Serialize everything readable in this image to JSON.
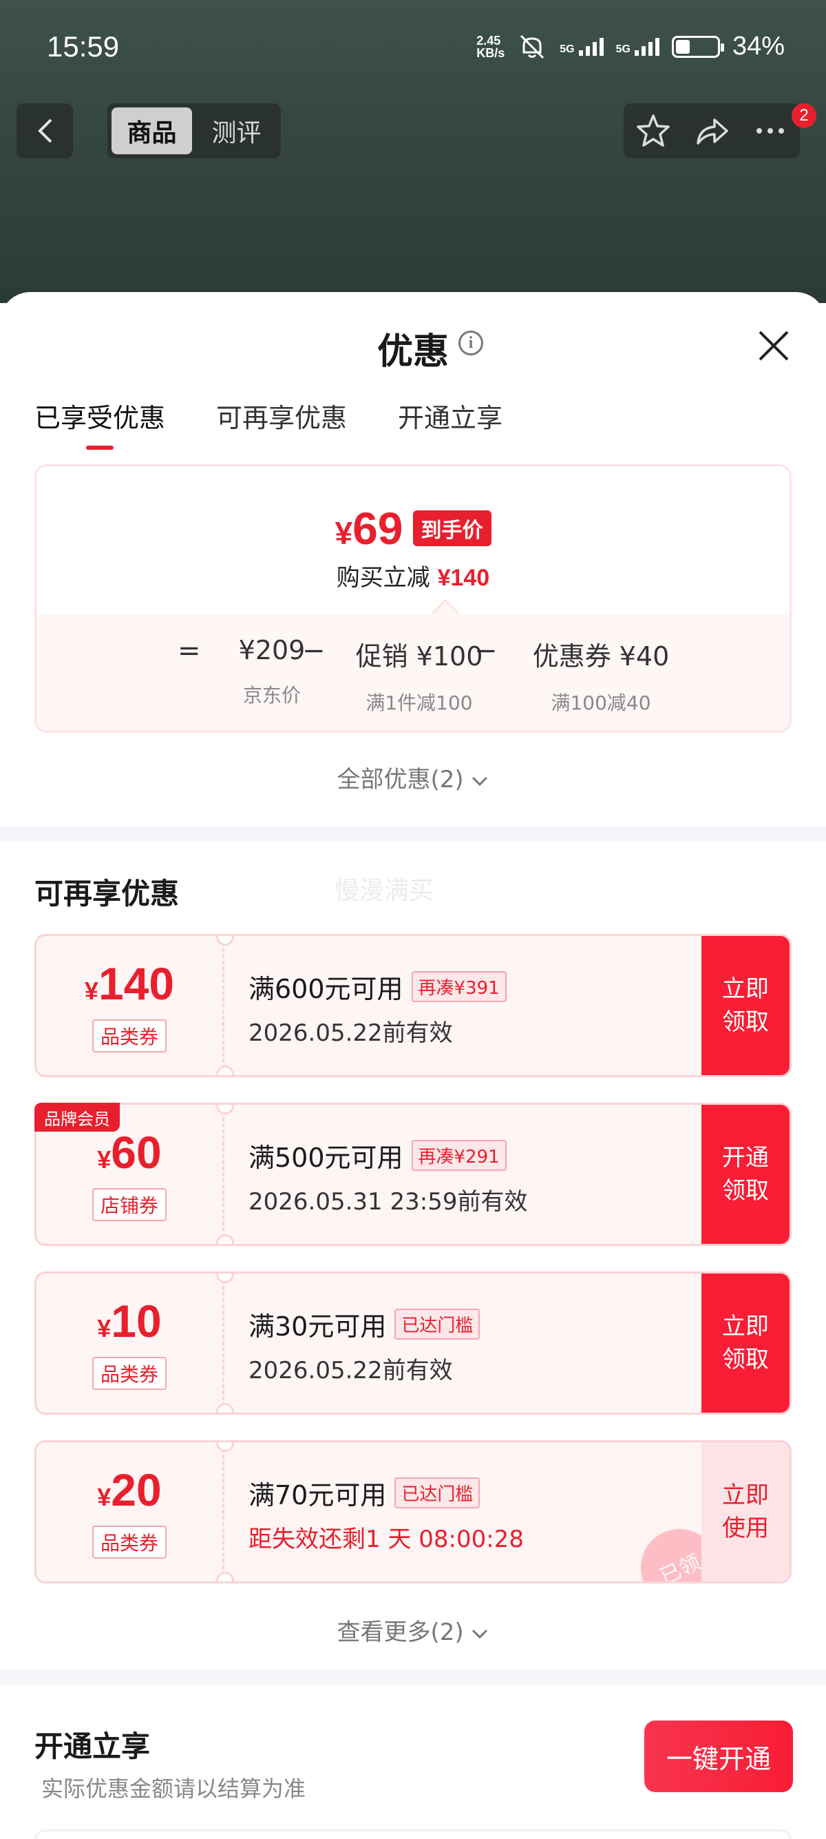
{
  "status_bar": {
    "time": "15:59",
    "net_speed_value": "2.45",
    "net_speed_unit": "KB/s",
    "signal1_label": "5G",
    "signal2_label": "5G",
    "battery_percent": "34%",
    "battery_level": 0.34
  },
  "top_bar": {
    "tabs": [
      "商品",
      "测评"
    ],
    "active_tab": "商品",
    "notification_count": "2"
  },
  "sheet": {
    "title": "优惠",
    "tabs": [
      "已享受优惠",
      "可再享优惠",
      "开通立享"
    ],
    "active_tab": "已享受优惠"
  },
  "price_card": {
    "final_price_symbol": "¥",
    "final_price": "69",
    "final_price_tag": "到手价",
    "reduction_label": "购买立减",
    "reduction_value": "¥140",
    "formula": [
      {
        "op": "=",
        "value": "¥209",
        "label": "京东价"
      },
      {
        "op": "−",
        "value": "促销 ¥100",
        "label": "满1件减100"
      },
      {
        "op": "−",
        "value": "优惠券 ¥40",
        "label": "满100减40"
      }
    ],
    "all_offers_link": "全部优惠(2)"
  },
  "more_offers": {
    "title": "可再享优惠",
    "watermark": "慢漫满买",
    "coupons": [
      {
        "yen": "¥",
        "amount": "140",
        "type": "品类券",
        "condition": "满600元可用",
        "tag": "再凑¥391",
        "validity": "2026.05.22前有效",
        "button": "立即\n领取",
        "badge": ""
      },
      {
        "yen": "¥",
        "amount": "60",
        "type": "店铺券",
        "condition": "满500元可用",
        "tag": "再凑¥291",
        "validity": "2026.05.31 23:59前有效",
        "button": "开通\n领取",
        "badge": "品牌会员"
      },
      {
        "yen": "¥",
        "amount": "10",
        "type": "品类券",
        "condition": "满30元可用",
        "tag": "已达门槛",
        "validity": "2026.05.22前有效",
        "button": "立即\n领取",
        "badge": ""
      },
      {
        "yen": "¥",
        "amount": "20",
        "type": "品类券",
        "condition": "满70元可用",
        "tag": "已达门槛",
        "validity": "距失效还剩1 天 08:00:28",
        "button": "立即\n使用",
        "badge": "",
        "stamp": "已领"
      }
    ],
    "see_more_link": "查看更多(2)"
  },
  "open_section": {
    "title": "开通立享",
    "subtitle": "实际优惠金额请以结算为准",
    "button": "一键开通"
  },
  "colors": {
    "accent_red": "#e8202d",
    "coupon_button_red": "#f91d35",
    "coupon_bg": "#fff5f5"
  }
}
